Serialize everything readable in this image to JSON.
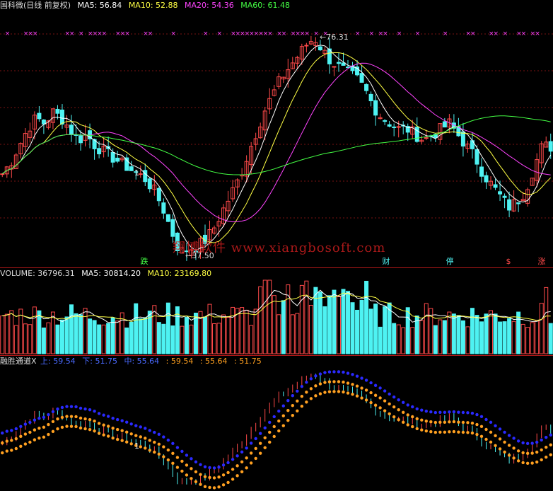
{
  "main_header": {
    "title": "国科微(日线 前复权)",
    "ma5_label": "MA5: 56.84",
    "ma10_label": "MA10: 52.88",
    "ma20_label": "MA20: 54.36",
    "ma60_label": "MA60: 61.48"
  },
  "volume_header": {
    "volume_label": "VOLUME: 36796.31",
    "ma5_label": "MA5: 30814.20",
    "ma10_label": "MA10: 23169.80"
  },
  "channel_header": {
    "title": "融胜通道X",
    "upper_label": "上: 59.54",
    "lower_label": "下: 51.75",
    "middle_label": "中: 55.64",
    "v1": ": 59.54",
    "v2": ": 55.64",
    "v3": ": 51.75"
  },
  "annotations": {
    "high": "76.31",
    "low": "37.50",
    "one_marker_a": "1",
    "one_marker_b": "1"
  },
  "watermark": "翔博软件 www.xiangbosoft.com",
  "tags": {
    "die": "跌",
    "cai": "财",
    "ting": "停",
    "dollar": "$",
    "zhang": "涨"
  },
  "colors": {
    "up": "#ff4a4a",
    "down": "#4ef2f2",
    "ma5": "#ffffff",
    "ma10": "#ffff44",
    "ma20": "#ff44ff",
    "ma60": "#44ff44",
    "channel_upper": "#2a2aff",
    "channel_lower": "#ffa020",
    "separator": "#b01818",
    "text_grey": "#dddddd",
    "header_blue": "#4a6aff"
  },
  "chart_data": [
    {
      "type": "candlestick",
      "title": "国科微(日线 前复权)",
      "series": [
        {
          "name": "MA5",
          "last": 56.84
        },
        {
          "name": "MA10",
          "last": 52.88
        },
        {
          "name": "MA20",
          "last": 54.36
        },
        {
          "name": "MA60",
          "last": 61.48
        }
      ],
      "annotations": {
        "high": 76.31,
        "low": 37.5
      },
      "close_path": [
        52,
        54,
        57,
        60,
        62,
        61,
        63,
        62,
        60,
        58,
        59,
        57,
        56,
        55,
        54,
        53,
        52,
        51,
        49,
        46,
        42,
        38,
        38.5,
        39,
        40,
        42,
        45,
        48,
        51,
        55,
        59,
        63,
        66,
        69,
        71,
        73,
        75,
        76.3,
        74,
        72,
        71,
        70,
        69,
        67,
        64,
        62,
        61,
        60,
        60,
        59,
        58,
        59,
        60,
        61,
        59,
        57,
        55,
        52,
        50,
        48,
        46,
        47,
        49,
        53,
        57,
        56.8
      ]
    },
    {
      "type": "bar",
      "title": "VOLUME",
      "series": [
        {
          "name": "VOLUME",
          "last": 36796.31
        },
        {
          "name": "MA5",
          "last": 30814.2
        },
        {
          "name": "MA10",
          "last": 23169.8
        }
      ]
    },
    {
      "type": "line",
      "title": "融胜通道X",
      "series": [
        {
          "name": "上",
          "last": 59.54
        },
        {
          "name": "中",
          "last": 55.64
        },
        {
          "name": "下",
          "last": 51.75
        }
      ]
    }
  ]
}
